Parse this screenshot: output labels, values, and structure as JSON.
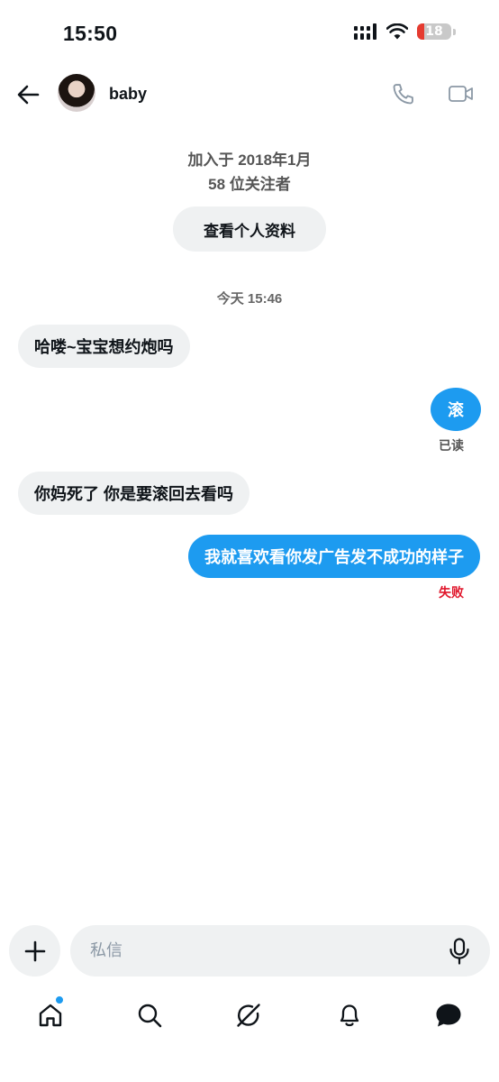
{
  "status_bar": {
    "time": "15:50",
    "battery": "18"
  },
  "header": {
    "contact_name": "baby"
  },
  "profile": {
    "joined": "加入于 2018年1月",
    "followers": "58 位关注者",
    "view_profile_label": "查看个人资料"
  },
  "thread": {
    "timestamp": "今天 15:46",
    "messages": [
      {
        "direction": "in",
        "text": "哈喽~宝宝想约炮吗"
      },
      {
        "direction": "out",
        "text": "滚",
        "status": "已读"
      },
      {
        "direction": "in",
        "text": "你妈死了 你是要滚回去看吗"
      },
      {
        "direction": "out",
        "text": "我就喜欢看你发广告发不成功的样子",
        "status": "失败"
      }
    ]
  },
  "composer": {
    "placeholder": "私信"
  },
  "nav": {
    "items": [
      "home-icon",
      "search-icon",
      "grok-icon",
      "bell-icon",
      "messages-icon"
    ],
    "home_has_notification": true
  },
  "colors": {
    "accent": "#1d9bf0",
    "bubble_in": "#eff1f2",
    "failed": "#e0162b"
  }
}
